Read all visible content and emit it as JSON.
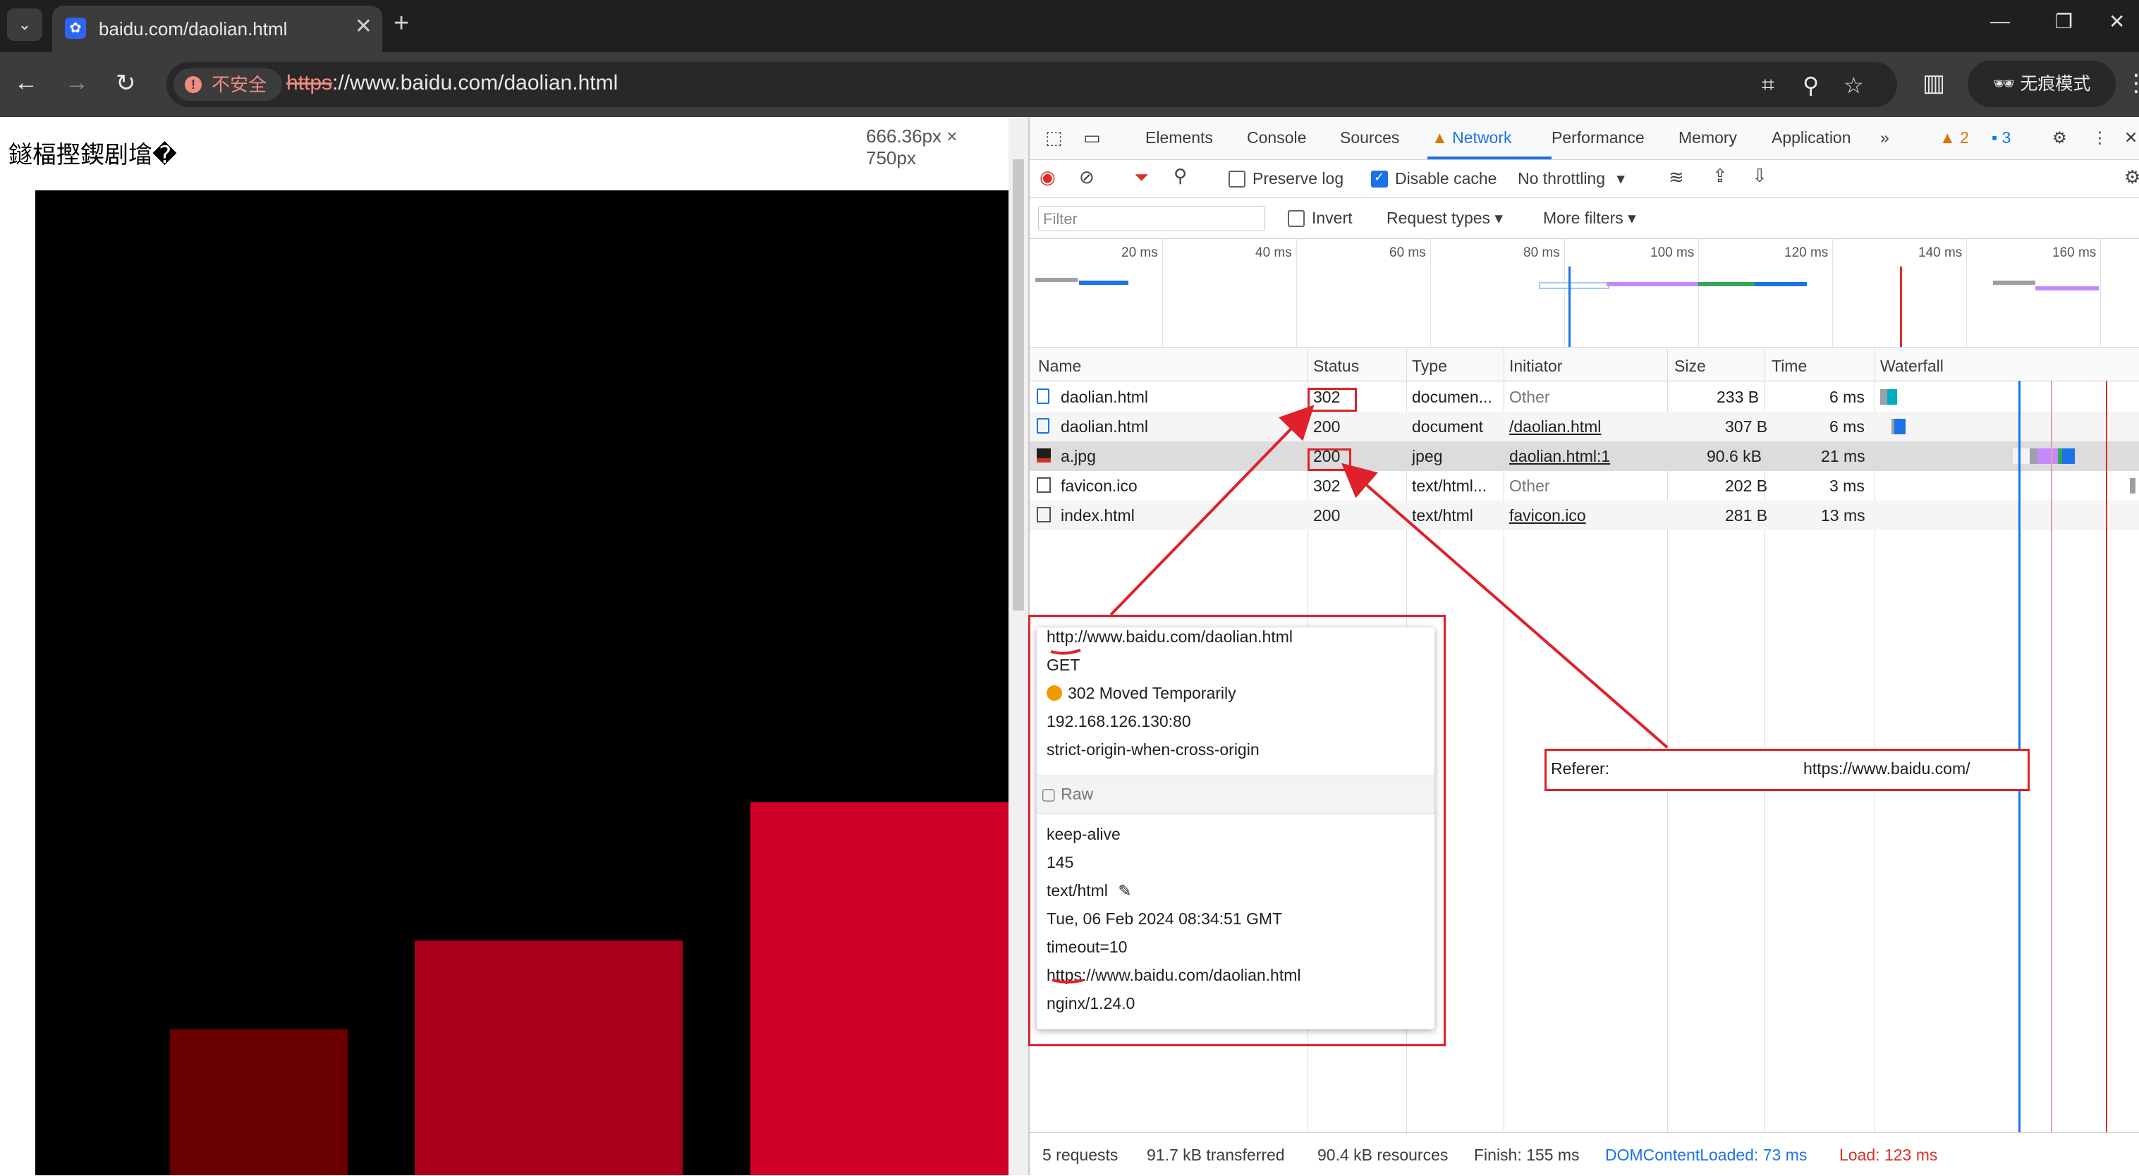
{
  "browser": {
    "tab_title": "baidu.com/daolian.html",
    "tab_close": "✕",
    "new_tab": "+",
    "security_label": "不安全",
    "url_scheme": "https",
    "url_rest": "://www.baidu.com/daolian.html",
    "incognito_label": "无痕模式"
  },
  "page": {
    "garbled_title": "鐩楅摼鍥剧墖�",
    "dimensions": "666.36px × 750px",
    "square_colors": [
      "#6b0000",
      "#a9001e",
      "#d1002a"
    ]
  },
  "devtools": {
    "tabs": [
      "Elements",
      "Console",
      "Sources",
      "Network",
      "Performance",
      "Memory",
      "Application"
    ],
    "active_tab": "Network",
    "warning_count": "2",
    "message_count": "3",
    "toolbar": {
      "preserve_log": "Preserve log",
      "preserve_log_checked": false,
      "disable_cache": "Disable cache",
      "disable_cache_checked": true,
      "throttling": "No throttling"
    },
    "filterbar": {
      "filter_placeholder": "Filter",
      "invert": "Invert",
      "request_types": "Request types",
      "more_filters": "More filters"
    },
    "overview_ticks": [
      "20 ms",
      "40 ms",
      "60 ms",
      "80 ms",
      "100 ms",
      "120 ms",
      "140 ms",
      "160 ms"
    ],
    "columns": [
      "Name",
      "Status",
      "Type",
      "Initiator",
      "Size",
      "Time",
      "Waterfall"
    ],
    "rows": [
      {
        "name": "daolian.html",
        "status": "302",
        "type": "documen...",
        "initiator": "Other",
        "size": "233 B",
        "time": "6 ms",
        "icon": "document-icon"
      },
      {
        "name": "daolian.html",
        "status": "200",
        "type": "document",
        "initiator": "/daolian.html",
        "size": "307 B",
        "time": "6 ms",
        "icon": "document-icon"
      },
      {
        "name": "a.jpg",
        "status": "200",
        "type": "jpeg",
        "initiator": "daolian.html:1",
        "size": "90.6 kB",
        "time": "21 ms",
        "icon": "image-icon"
      },
      {
        "name": "favicon.ico",
        "status": "302",
        "type": "text/html...",
        "initiator": "Other",
        "size": "202 B",
        "time": "3 ms",
        "icon": "blank-icon"
      },
      {
        "name": "index.html",
        "status": "200",
        "type": "text/html",
        "initiator": "favicon.ico",
        "size": "281 B",
        "time": "13 ms",
        "icon": "blank-icon"
      }
    ],
    "status_bar": {
      "requests": "5 requests",
      "transferred": "91.7 kB transferred",
      "resources": "90.4 kB resources",
      "finish": "Finish: 155 ms",
      "dcl": "DOMContentLoaded: 73 ms",
      "load": "Load: 123 ms"
    }
  },
  "tooltip": {
    "url": "http://www.baidu.com/daolian.html",
    "method": "GET",
    "status": "302 Moved Temporarily",
    "remote_address": "192.168.126.130:80",
    "referrer_policy": "strict-origin-when-cross-origin",
    "raw_label": "Raw",
    "connection": "keep-alive",
    "content_length": "145",
    "content_type": "text/html",
    "date": "Tue, 06 Feb 2024 08:34:51 GMT",
    "keep_alive": "timeout=10",
    "location": "https://www.baidu.com/daolian.html",
    "server": "nginx/1.24.0"
  },
  "referer": {
    "label": "Referer:",
    "value": "https://www.baidu.com/"
  },
  "colors": {
    "accent": "#1a73e8",
    "annotation_red": "#e0202a",
    "load_red": "#d93025"
  }
}
